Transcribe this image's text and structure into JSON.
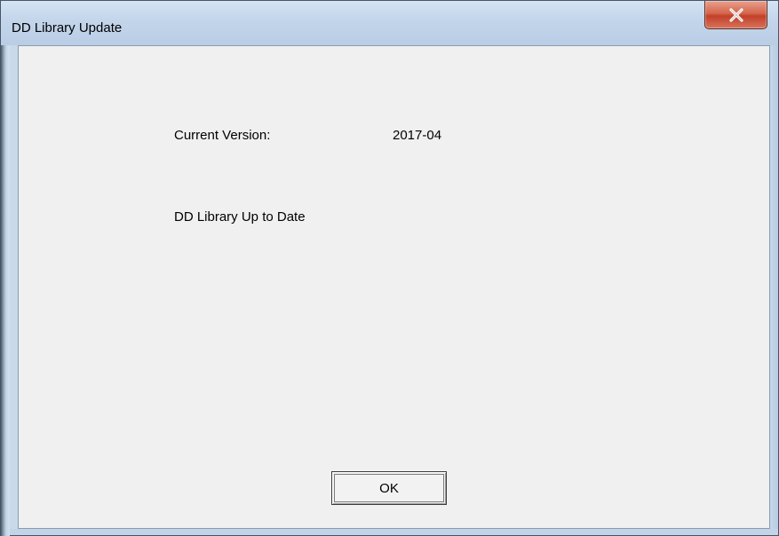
{
  "window": {
    "title": "DD Library Update"
  },
  "titlebar": {
    "close_icon": "close-x-icon"
  },
  "content": {
    "version_label": "Current Version:",
    "version_value": "2017-04",
    "status_message": "DD Library Up to Date"
  },
  "buttons": {
    "ok_label": "OK"
  },
  "colors": {
    "close_button": "#c2402a",
    "client_background": "#f0f0f0",
    "frame": "#c9d9ea"
  }
}
